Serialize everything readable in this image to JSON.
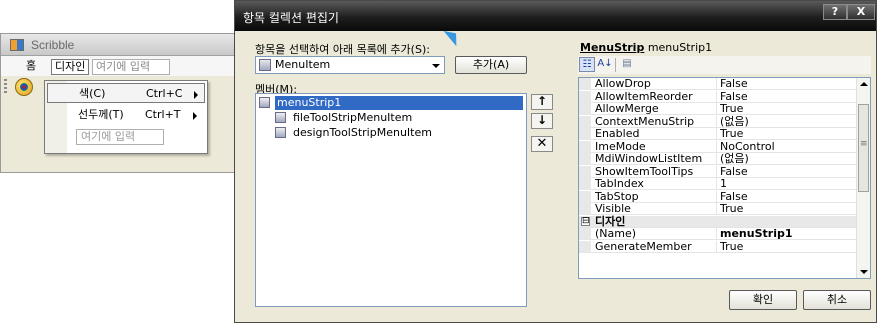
{
  "scribble": {
    "title": "Scribble",
    "menu": {
      "home": "홈",
      "design": "디자인",
      "type_here": "여기에 입력"
    },
    "dropdown": {
      "items": [
        {
          "label": "색(C)",
          "shortcut": "Ctrl+C"
        },
        {
          "label": "선두께(T)",
          "shortcut": "Ctrl+T"
        }
      ],
      "type_here": "여기에 입력"
    }
  },
  "dialog": {
    "title": "항목 컬렉션 편집기",
    "help_label": "?",
    "close_label": "X",
    "add_prompt": "항목을 선택하여 아래 목록에 추가(S):",
    "item_type": "MenuItem",
    "add_button": "추가(A)",
    "members_label": "멤버(M):",
    "members": [
      "menuStrip1",
      "fileToolStripMenuItem",
      "designToolStripMenuItem"
    ],
    "up_symbol": "↑",
    "down_symbol": "↓",
    "remove_symbol": "✕",
    "properties": {
      "header_type": "MenuStrip",
      "header_name": "menuStrip1",
      "toolbar": {
        "categorized": "☷",
        "alphabetical": "A↓",
        "pages": "▤"
      },
      "rows": [
        {
          "name": "AllowDrop",
          "value": "False"
        },
        {
          "name": "AllowItemReorder",
          "value": "False"
        },
        {
          "name": "AllowMerge",
          "value": "True"
        },
        {
          "name": "ContextMenuStrip",
          "value": "(없음)"
        },
        {
          "name": "Enabled",
          "value": "True"
        },
        {
          "name": "ImeMode",
          "value": "NoControl"
        },
        {
          "name": "MdiWindowListItem",
          "value": "(없음)"
        },
        {
          "name": "ShowItemToolTips",
          "value": "False"
        },
        {
          "name": "TabIndex",
          "value": "1"
        },
        {
          "name": "TabStop",
          "value": "False"
        },
        {
          "name": "Visible",
          "value": "True"
        }
      ],
      "category": {
        "expander": "⊟",
        "name": "디자인"
      },
      "design_rows": [
        {
          "name": "(Name)",
          "value": "menuStrip1"
        },
        {
          "name": "GenerateMember",
          "value": "True"
        }
      ]
    },
    "ok_button": "확인",
    "cancel_button": "취소"
  }
}
